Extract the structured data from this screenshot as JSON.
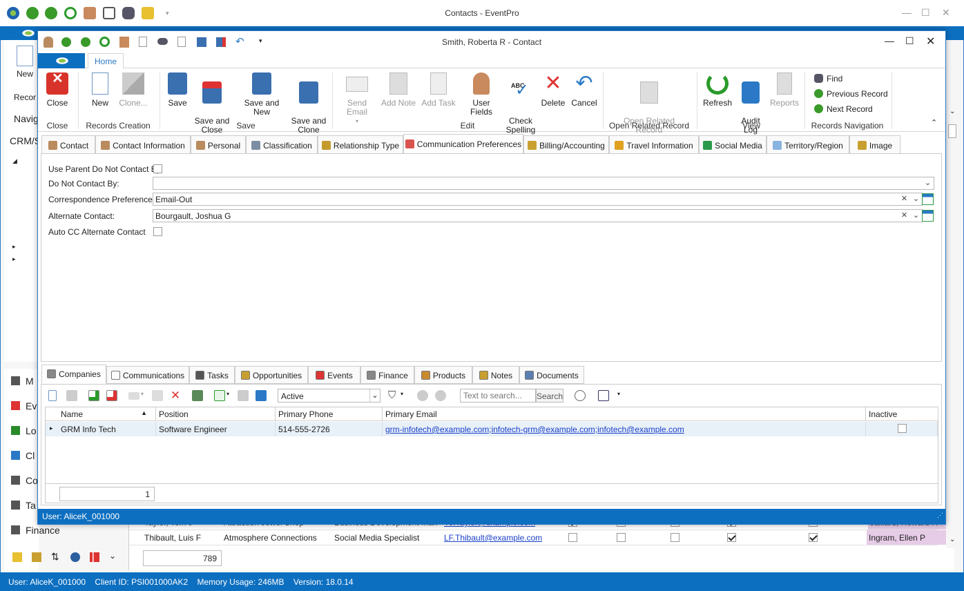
{
  "outer": {
    "title": "Contacts - EventPro",
    "ribbon_new": "New",
    "ribbon_records": "Recor",
    "nav_header": "Navig",
    "crm_label": "CRM/S",
    "nav_list": [
      {
        "label": "M",
        "color": "#555"
      },
      {
        "label": "Ev",
        "color": "#d33"
      },
      {
        "label": "Lo",
        "color": "#2a8a2a"
      },
      {
        "label": "Cl",
        "color": "#2b79c6"
      },
      {
        "label": "Co",
        "color": "#555"
      },
      {
        "label": "Ta",
        "color": "#555"
      },
      {
        "label": "Finance",
        "color": "#555"
      }
    ],
    "grid_rows": [
      {
        "name": "Taylor, Tom J",
        "company": "Attraction Jewel Shop",
        "position": "Business Development Mana...",
        "email": "TJ.Taylor@example.com",
        "checks": [
          true,
          false,
          false,
          true,
          false,
          false
        ],
        "owner": "Jalliard, Howard R"
      },
      {
        "name": "Thibault, Luis F",
        "company": "Atmosphere Connections",
        "position": "Social Media Specialist",
        "email": "LF.Thibault@example.com",
        "checks": [
          false,
          false,
          false,
          true,
          false,
          true
        ],
        "owner": "Ingram, Ellen P"
      }
    ],
    "grid_count": "789",
    "status": "User: AliceK_001000    Client ID: PSI001000AK2    Memory Usage: 246MB    Version: 18.0.14"
  },
  "dialog": {
    "title": "Smith, Roberta R - Contact",
    "home_tab": "Home",
    "ribbon": {
      "close": "Close",
      "new": "New",
      "clone": "Clone...",
      "save": "Save",
      "save_close": "Save and\nClose",
      "save_new": "Save and New",
      "save_clone": "Save and\nClone",
      "send_email": "Send Email",
      "add_note": "Add Note",
      "add_task": "Add Task",
      "user_fields": "User Fields",
      "check_spelling": "Check\nSpelling",
      "delete": "Delete",
      "cancel": "Cancel",
      "open_related": "Open Related\nRecord",
      "refresh": "Refresh",
      "audit_log": "Audit\nLog",
      "reports": "Reports",
      "find": "Find",
      "previous_record": "Previous Record",
      "next_record": "Next Record",
      "groups": {
        "close": "Close",
        "records_creation": "Records Creation",
        "save": "Save",
        "edit": "Edit",
        "open_related": "Open Related Record",
        "view": "View",
        "records_navigation": "Records Navigation"
      }
    },
    "tabs": [
      {
        "label": "Contact",
        "color": "#b98b5e"
      },
      {
        "label": "Contact Information",
        "color": "#b98b5e"
      },
      {
        "label": "Personal",
        "color": "#b98b5e"
      },
      {
        "label": "Classification",
        "color": "#7d8ea3"
      },
      {
        "label": "Relationship Type",
        "color": "#c49a2c"
      },
      {
        "label": "Communication Preferences",
        "color": "#d9534f"
      },
      {
        "label": "Billing/Accounting",
        "color": "#c9a030"
      },
      {
        "label": "Travel Information",
        "color": "#e0a020"
      },
      {
        "label": "Social Media",
        "color": "#2a9a4a"
      },
      {
        "label": "Territory/Region",
        "color": "#8ab4e0"
      },
      {
        "label": "Image",
        "color": "#c9a030"
      }
    ],
    "form": {
      "use_parent_label": "Use Parent Do Not Contact By",
      "do_not_contact_label": "Do Not Contact By:",
      "do_not_contact_value": "",
      "correspondence_label": "Correspondence Preference:",
      "correspondence_value": "Email-Out",
      "alternate_label": "Alternate Contact:",
      "alternate_value": "Bourgault, Joshua G",
      "auto_cc_label": "Auto CC Alternate Contact"
    },
    "bottom_tabs": [
      {
        "label": "Companies",
        "color": "#888"
      },
      {
        "label": "Communications",
        "color": "#fff"
      },
      {
        "label": "Tasks",
        "color": "#555"
      },
      {
        "label": "Opportunities",
        "color": "#c9a030"
      },
      {
        "label": "Events",
        "color": "#d33"
      },
      {
        "label": "Finance",
        "color": "#888"
      },
      {
        "label": "Products",
        "color": "#c98a30"
      },
      {
        "label": "Notes",
        "color": "#c9a030"
      },
      {
        "label": "Documents",
        "color": "#5a7fb0"
      }
    ],
    "filter_value": "Active",
    "search_placeholder": "Text to search...",
    "search_button": "Search",
    "grid": {
      "columns": [
        "Name",
        "Position",
        "Primary Phone",
        "Primary Email",
        "Inactive"
      ],
      "rows": [
        {
          "name": "GRM Info Tech",
          "position": "Software Engineer",
          "phone": "514-555-2726",
          "email": "grm-infotech@example.com;infotech-grm@example.com;infotech@example.com",
          "inactive": false
        }
      ],
      "count": "1"
    },
    "status": "User: AliceK_001000"
  }
}
